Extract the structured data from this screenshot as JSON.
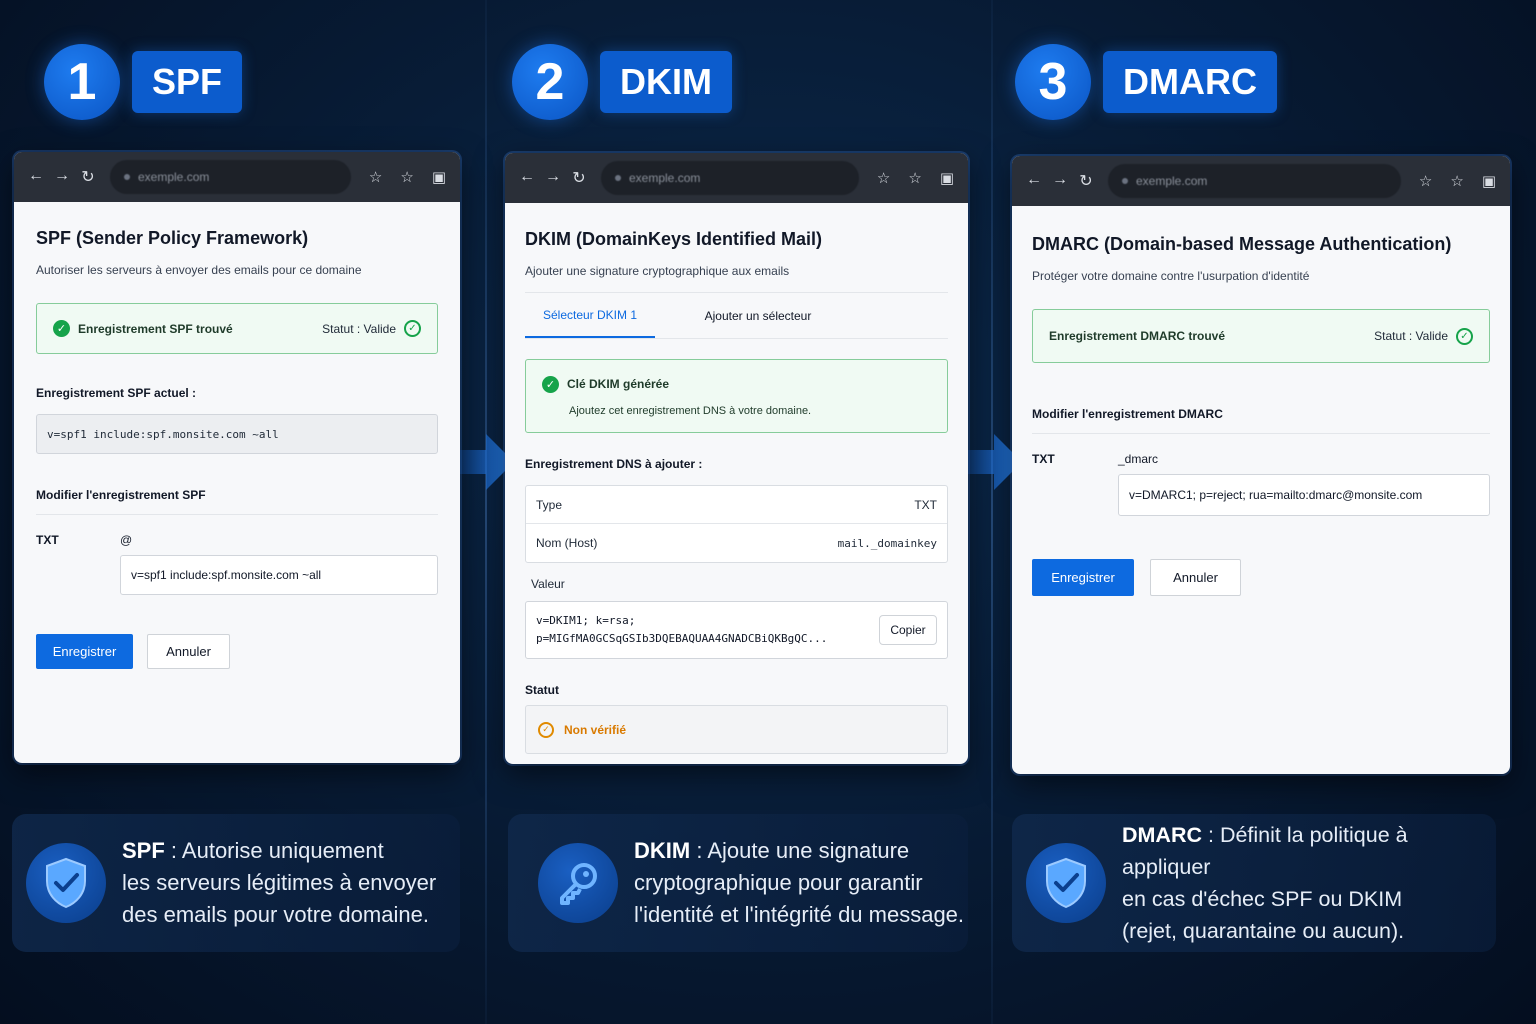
{
  "steps": [
    {
      "number": "1",
      "label": "SPF"
    },
    {
      "number": "2",
      "label": "DKIM"
    },
    {
      "number": "3",
      "label": "DMARC"
    }
  ],
  "spf": {
    "url": "exemple.com",
    "title": "SPF (Sender Policy Framework)",
    "subtitle": "Autoriser les serveurs à envoyer des emails pour ce domaine",
    "found": "Enregistrement SPF trouvé",
    "status": "Statut : Valide",
    "current_label": "Enregistrement SPF actuel :",
    "current_value": "v=spf1 include:spf.monsite.com ~all",
    "edit_label": "Modifier l'enregistrement SPF",
    "type": "TXT",
    "host": "@",
    "input_value": "v=spf1 include:spf.monsite.com ~all",
    "save": "Enregistrer",
    "cancel": "Annuler"
  },
  "dkim": {
    "url": "exemple.com",
    "title": "DKIM (DomainKeys Identified Mail)",
    "subtitle": "Ajouter une signature cryptographique aux emails",
    "tab1": "Sélecteur DKIM 1",
    "tab2": "Ajouter un sélecteur",
    "generated": "Clé DKIM générée",
    "generated_hint": "Ajoutez cet enregistrement DNS à votre domaine.",
    "dns_label": "Enregistrement DNS à ajouter :",
    "type_key": "Type",
    "type_val": "TXT",
    "host_key": "Nom (Host)",
    "host_val": "mail._domainkey",
    "value_label": "Valeur",
    "value_line1": "v=DKIM1; k=rsa;",
    "value_line2": "p=MIGfMA0GCSqGSIb3DQEBAQUAA4GNADCBiQKBgQC...",
    "copy": "Copier",
    "status_label": "Statut",
    "status_value": "Non vérifié"
  },
  "dmarc": {
    "url": "exemple.com",
    "title": "DMARC (Domain-based Message Authentication)",
    "subtitle": "Protéger votre domaine contre l'usurpation d'identité",
    "found": "Enregistrement DMARC trouvé",
    "status": "Statut : Valide",
    "edit_label": "Modifier l'enregistrement DMARC",
    "type": "TXT",
    "host": "_dmarc",
    "input_value": "v=DMARC1; p=reject; rua=mailto:dmarc@monsite.com",
    "save": "Enregistrer",
    "cancel": "Annuler"
  },
  "info": [
    {
      "name": "SPF",
      "sep": " : ",
      "text": "Autorise uniquement les serveurs légitimes à envoyer des emails pour votre domaine.",
      "line1": "Autorise uniquement",
      "line2": "les serveurs légitimes à envoyer",
      "line3": "des emails pour votre domaine."
    },
    {
      "name": "DKIM",
      "sep": " : ",
      "line1": "Ajoute une signature",
      "line2": "cryptographique pour garantir",
      "line3": "l'identité et l'intégrité du message."
    },
    {
      "name": "DMARC",
      "sep": " : ",
      "line1": "Définit la politique à appliquer",
      "line2": "en cas d'échec SPF ou DKIM",
      "line3": "(rejet, quarantaine ou aucun)."
    }
  ],
  "colors": {
    "accent": "#0d6ae0",
    "success": "#16a34a",
    "warning": "#e08a00",
    "background": "#071a33"
  }
}
